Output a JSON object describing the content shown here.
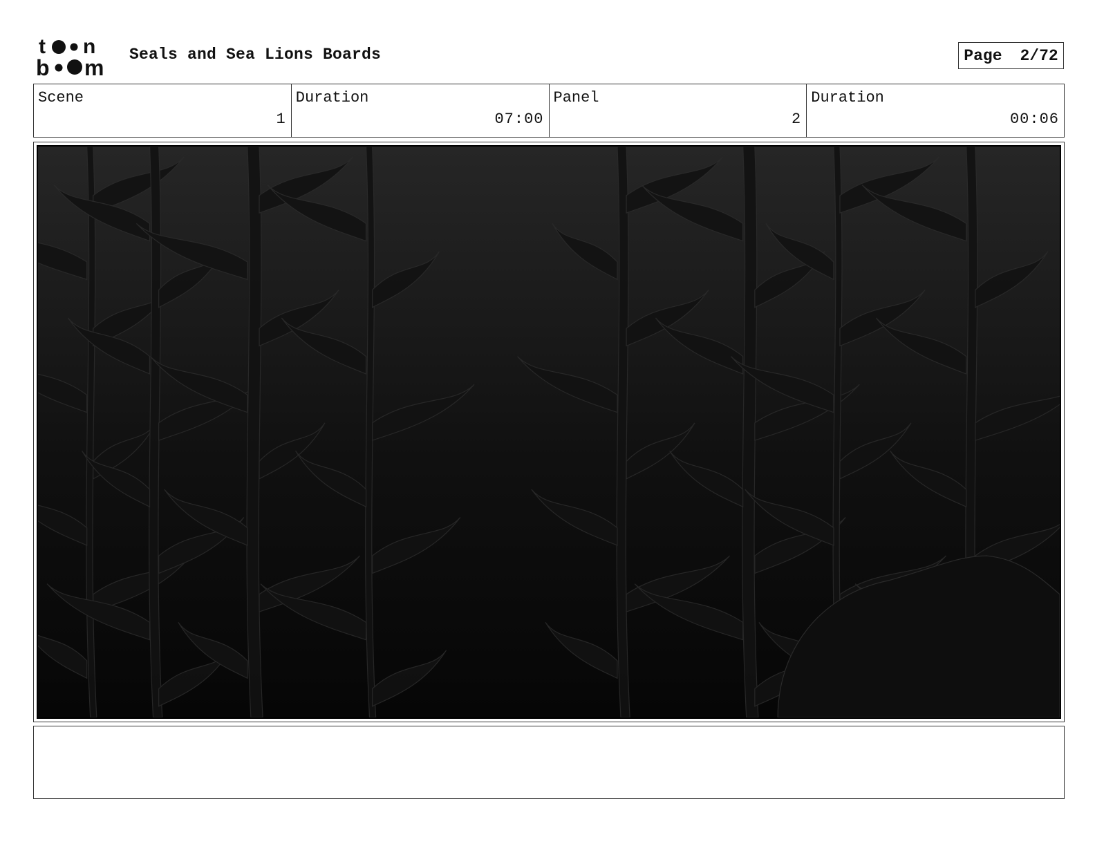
{
  "header": {
    "logo_text_top": "toon",
    "logo_text_bottom": "boom",
    "title": "Seals and Sea Lions Boards",
    "page_label": "Page",
    "page_value": "2/72"
  },
  "info": [
    {
      "label": "Scene",
      "value": "1"
    },
    {
      "label": "Duration",
      "value": "07:00"
    },
    {
      "label": "Panel",
      "value": "2"
    },
    {
      "label": "Duration",
      "value": "00:06"
    }
  ],
  "panel": {
    "description": "",
    "colors": {
      "background_top": "#262626",
      "background_bottom": "#050505",
      "kelp": "#101010"
    }
  },
  "notes": {
    "text": ""
  }
}
